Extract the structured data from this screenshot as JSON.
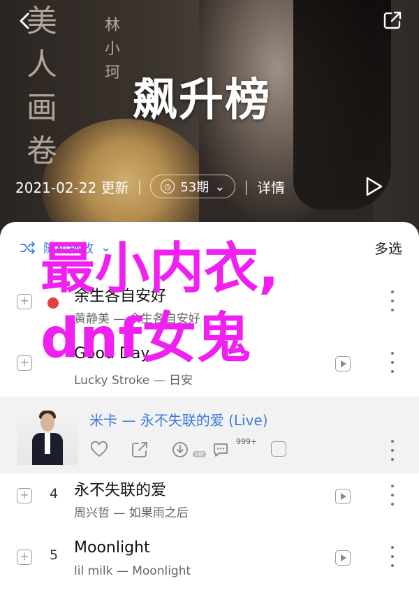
{
  "header": {
    "title": "飙升榜",
    "calligraphy_main": "美人画卷",
    "calligraphy_side": "林小珂",
    "date": "2021-02-22 更新",
    "comments_count": "53期",
    "detail_label": "详情"
  },
  "list": {
    "shuffle_label": "随机播放",
    "multi_select_label": "多选",
    "songs": [
      {
        "index": "",
        "title": "余生各自安好",
        "artist": "黄静美 — 余生各自安好"
      },
      {
        "index": "",
        "title": "Good Day",
        "artist": "Lucky Stroke — 日安"
      },
      {
        "index": "4",
        "title": "永不失联的爱",
        "artist": "周兴哲 — 如果雨之后"
      },
      {
        "index": "5",
        "title": "Moonlight",
        "artist": "lil milk — Moonlight"
      }
    ],
    "featured": {
      "title": "米卡 — 永不失联的爱 (Live)",
      "comment_badge": "999+",
      "vip_label": "VIP"
    }
  },
  "overlay_text": "最小内衣, dnf女鬼",
  "colors": {
    "accent": "#3a7be0",
    "overlay": "#f020f0",
    "rank_dot": "#e54141"
  }
}
